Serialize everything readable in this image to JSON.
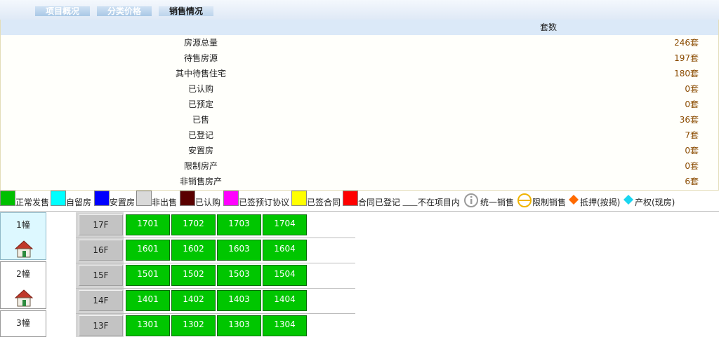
{
  "tabs": [
    {
      "label": "项目概况",
      "active": false
    },
    {
      "label": "分类价格",
      "active": false
    },
    {
      "label": "销售情况",
      "active": true
    }
  ],
  "stats": {
    "header": "套数",
    "rows": [
      {
        "label": "房源总量",
        "value": "246套"
      },
      {
        "label": "待售房源",
        "value": "197套"
      },
      {
        "label": "其中待售住宅",
        "value": "180套"
      },
      {
        "label": "已认购",
        "value": "0套"
      },
      {
        "label": "已预定",
        "value": "0套"
      },
      {
        "label": "已售",
        "value": "36套"
      },
      {
        "label": "已登记",
        "value": "7套"
      },
      {
        "label": "安置房",
        "value": "0套"
      },
      {
        "label": "限制房产",
        "value": "0套"
      },
      {
        "label": "非销售房产",
        "value": "6套"
      }
    ]
  },
  "legend": {
    "colors": [
      {
        "label": "正常发售",
        "color": "#00c000"
      },
      {
        "label": "自留房",
        "color": "#00ffff"
      },
      {
        "label": "安置房",
        "color": "#0000ff"
      },
      {
        "label": "非出售",
        "color": "#d9d9d9"
      },
      {
        "label": "已认购",
        "color": "#5a0000"
      },
      {
        "label": "已签预订协议",
        "color": "#ff00ff"
      },
      {
        "label": "已签合同",
        "color": "#ffff00"
      },
      {
        "label": "合同已登记",
        "color": "#ff0000"
      },
      {
        "label": "不在项目内",
        "color": "#ffffff"
      }
    ],
    "icons": [
      {
        "label": "统一销售",
        "icon": "info-circle-icon"
      },
      {
        "label": "限制销售",
        "icon": "restricted-circle-icon"
      },
      {
        "label": "抵押(按揭)",
        "icon": "orange-diamond-icon"
      },
      {
        "label": "产权(现房)",
        "icon": "cyan-diamond-icon"
      }
    ]
  },
  "buildings": [
    {
      "name": "1幢",
      "active": true
    },
    {
      "name": "2幢",
      "active": false
    },
    {
      "name": "3幢",
      "active": false
    }
  ],
  "floors": [
    {
      "label": "17F",
      "units": [
        "1701",
        "1702",
        "1703",
        "1704"
      ]
    },
    {
      "label": "16F",
      "units": [
        "1601",
        "1602",
        "1603",
        "1604"
      ]
    },
    {
      "label": "15F",
      "units": [
        "1501",
        "1502",
        "1503",
        "1504"
      ]
    },
    {
      "label": "14F",
      "units": [
        "1401",
        "1402",
        "1403",
        "1404"
      ]
    },
    {
      "label": "13F",
      "units": [
        "1301",
        "1302",
        "1303",
        "1304"
      ]
    }
  ],
  "unit_status_color": "#00c600"
}
